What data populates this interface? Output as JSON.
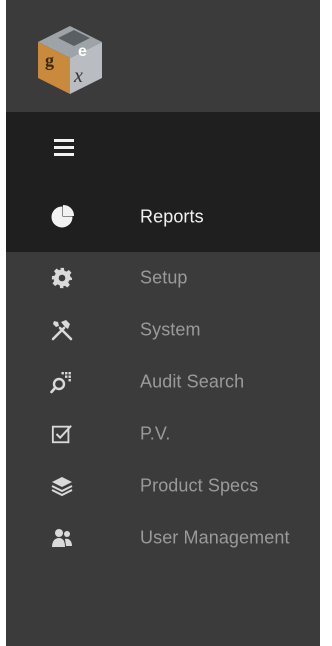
{
  "colors": {
    "sidebar_bg": "#3b3b3b",
    "active_bg": "#1f1f1f",
    "active_text": "#f2f2f2",
    "inactive_text": "#9a9a9a"
  },
  "nav": {
    "items": [
      {
        "label": "Reports",
        "icon": "pie-chart-icon",
        "active": true
      },
      {
        "label": "Setup",
        "icon": "gear-icon",
        "active": false
      },
      {
        "label": "System",
        "icon": "tools-icon",
        "active": false
      },
      {
        "label": "Audit Search",
        "icon": "search-icon",
        "active": false
      },
      {
        "label": "P.V.",
        "icon": "checkbox-icon",
        "active": false
      },
      {
        "label": "Product Specs",
        "icon": "layers-icon",
        "active": false
      },
      {
        "label": "User Management",
        "icon": "users-icon",
        "active": false
      }
    ]
  }
}
